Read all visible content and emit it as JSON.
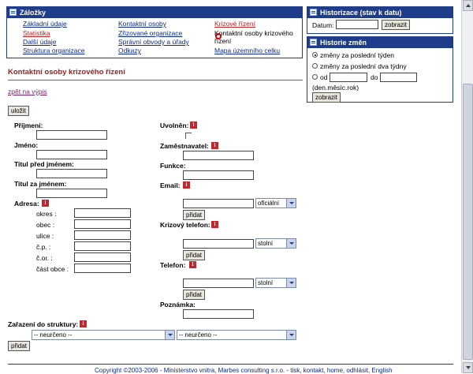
{
  "zalozky": {
    "title": "Záložky",
    "col1": [
      "Základní údaje",
      "Statistika",
      "Další údaje",
      "Struktura organizace"
    ],
    "col2": [
      "Kontaktní osoby",
      "Zřizované organizace",
      "Správní obvody a úřady",
      "Odkazy"
    ],
    "col3": [
      "Krizové řízení",
      "Kontaktní osoby krizového řízení",
      "Mapa územního celku"
    ]
  },
  "historizace": {
    "title": "Historizace (stav k datu)",
    "datum_label": "Datum:",
    "datum_value": "",
    "button": "zobrazit"
  },
  "historie": {
    "title": "Historie změn",
    "options": [
      "změny za poslední týden",
      "změny za poslední dva týdny"
    ],
    "od_label": "od",
    "do_label": "do",
    "format_hint": "(den.měsíc.rok)",
    "button": "zobrazit"
  },
  "page": {
    "heading": "Kontaktní osoby krizového řízení",
    "back_link": "zpět na výpis",
    "save_button": "uložit"
  },
  "form": {
    "prijmeni": "Příjmení:",
    "jmeno": "Jméno:",
    "titul_pred": "Titul před jménem:",
    "titul_za": "Titul za jménem:",
    "adresa": "Adresa:",
    "adresa_fields": [
      "okres :",
      "obec :",
      "ulice :",
      "č.p. :",
      "č.or. :",
      "část obce :"
    ],
    "uvolnen": "Uvolněn:",
    "zamestnavatel": "Zaměstnavatel:",
    "funkce": "Funkce:",
    "email": "Email:",
    "email_type": "oficiální",
    "krizovy_telefon": "Krizový telefon:",
    "krizovy_type": "stolní",
    "telefon": "Telefon:",
    "telefon_type": "stolní",
    "poznamka": "Poznámka:",
    "pridat": "přidat",
    "zarazeni": "Zařazení do struktury:",
    "neurceno": "-- neurčeno --"
  },
  "footer": {
    "copyright": "Copyright ©2003-2006 - Ministerstvo vnitra, Marbes consulting s.r.o. - tisk, kontakt, home, odhlásit, English"
  },
  "colors": {
    "brand": "#1e3c8a",
    "heading": "#a02020",
    "info_icon": "#c0282d"
  }
}
